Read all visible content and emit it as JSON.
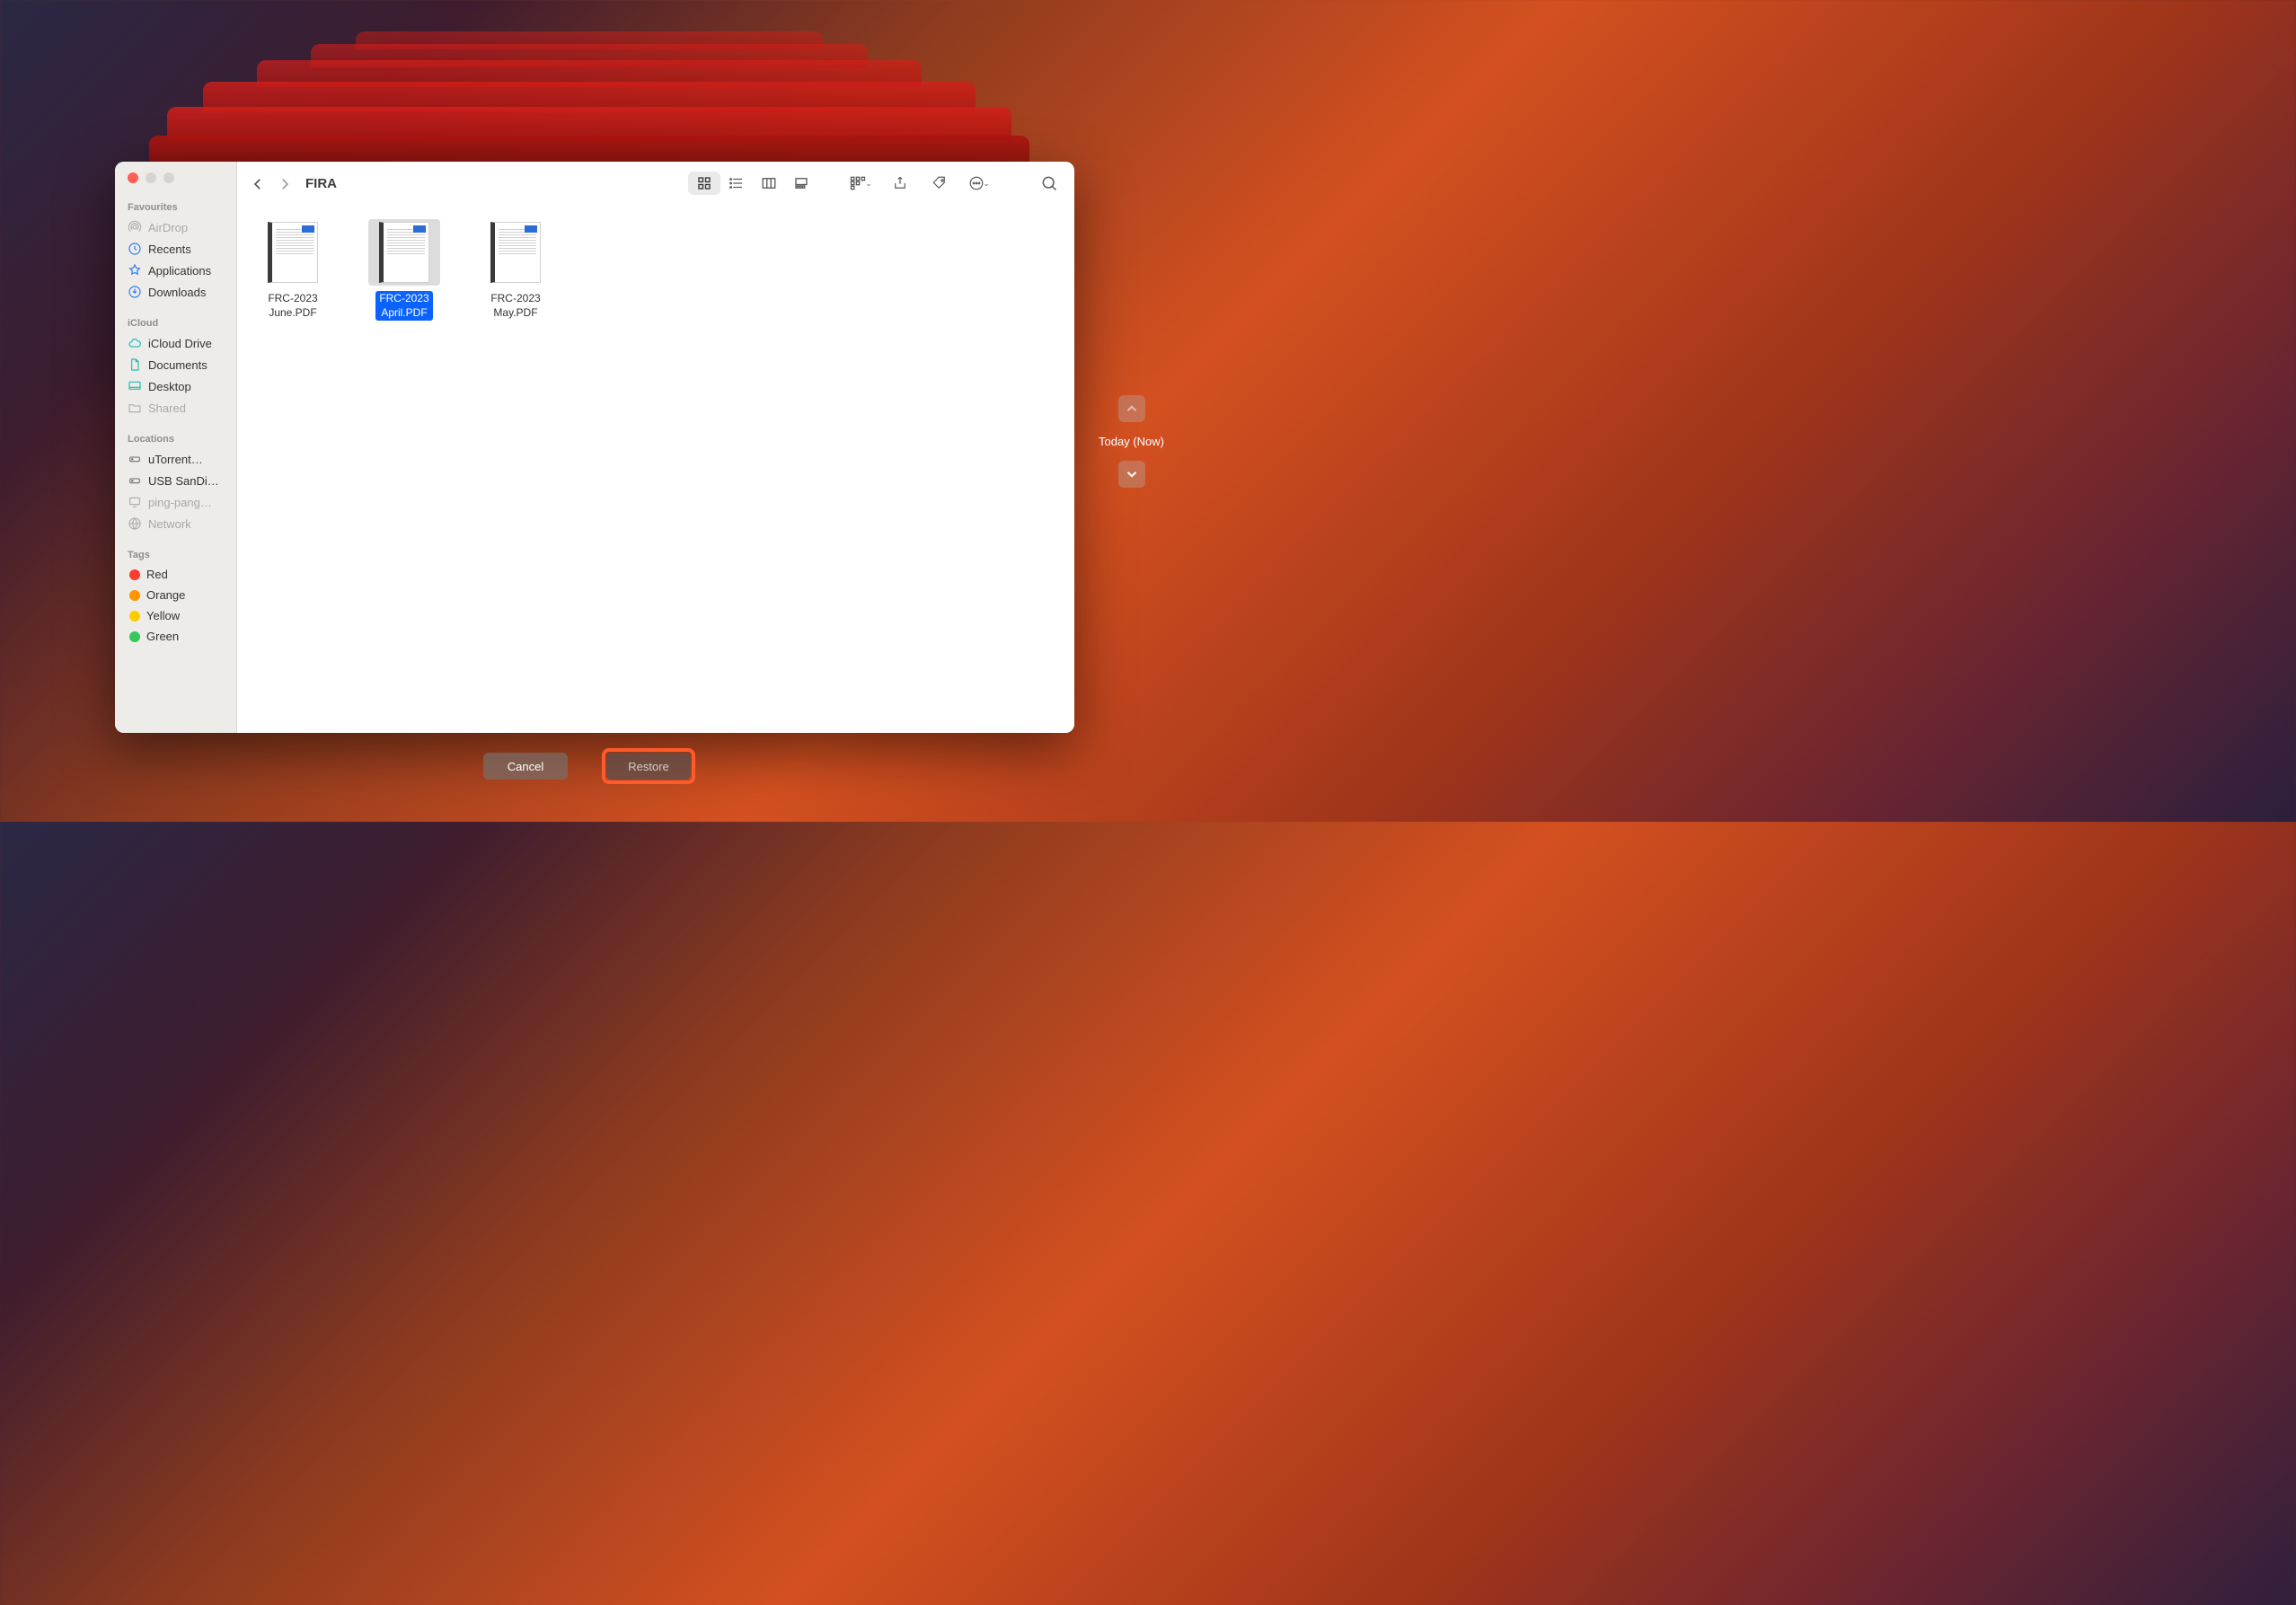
{
  "folder_title": "FIRA",
  "sidebar": {
    "sections": [
      {
        "header": "Favourites",
        "items": [
          {
            "label": "AirDrop",
            "icon": "airdrop",
            "disabled": true
          },
          {
            "label": "Recents",
            "icon": "recents",
            "disabled": false
          },
          {
            "label": "Applications",
            "icon": "applications",
            "disabled": false
          },
          {
            "label": "Downloads",
            "icon": "downloads",
            "disabled": false
          }
        ]
      },
      {
        "header": "iCloud",
        "items": [
          {
            "label": "iCloud Drive",
            "icon": "cloud",
            "disabled": false
          },
          {
            "label": "Documents",
            "icon": "document",
            "disabled": false
          },
          {
            "label": "Desktop",
            "icon": "desktop",
            "disabled": false
          },
          {
            "label": "Shared",
            "icon": "folder",
            "disabled": true
          }
        ]
      },
      {
        "header": "Locations",
        "items": [
          {
            "label": "uTorrent…",
            "icon": "disk",
            "disabled": false
          },
          {
            "label": "USB SanDi…",
            "icon": "disk",
            "disabled": false
          },
          {
            "label": "ping-pang…",
            "icon": "screen",
            "disabled": true
          },
          {
            "label": "Network",
            "icon": "globe",
            "disabled": true
          }
        ]
      },
      {
        "header": "Tags",
        "items": [
          {
            "label": "Red",
            "color": "#ff3b30"
          },
          {
            "label": "Orange",
            "color": "#ff9500"
          },
          {
            "label": "Yellow",
            "color": "#ffcc00"
          },
          {
            "label": "Green",
            "color": "#34c759"
          }
        ]
      }
    ]
  },
  "files": [
    {
      "name_line1": "FRC-2023",
      "name_line2": "June.PDF",
      "selected": false
    },
    {
      "name_line1": "FRC-2023",
      "name_line2": "April.PDF",
      "selected": true
    },
    {
      "name_line1": "FRC-2023",
      "name_line2": "May.PDF",
      "selected": false
    }
  ],
  "timeline": {
    "timestamp": "Today (Now)"
  },
  "buttons": {
    "cancel": "Cancel",
    "restore": "Restore"
  }
}
